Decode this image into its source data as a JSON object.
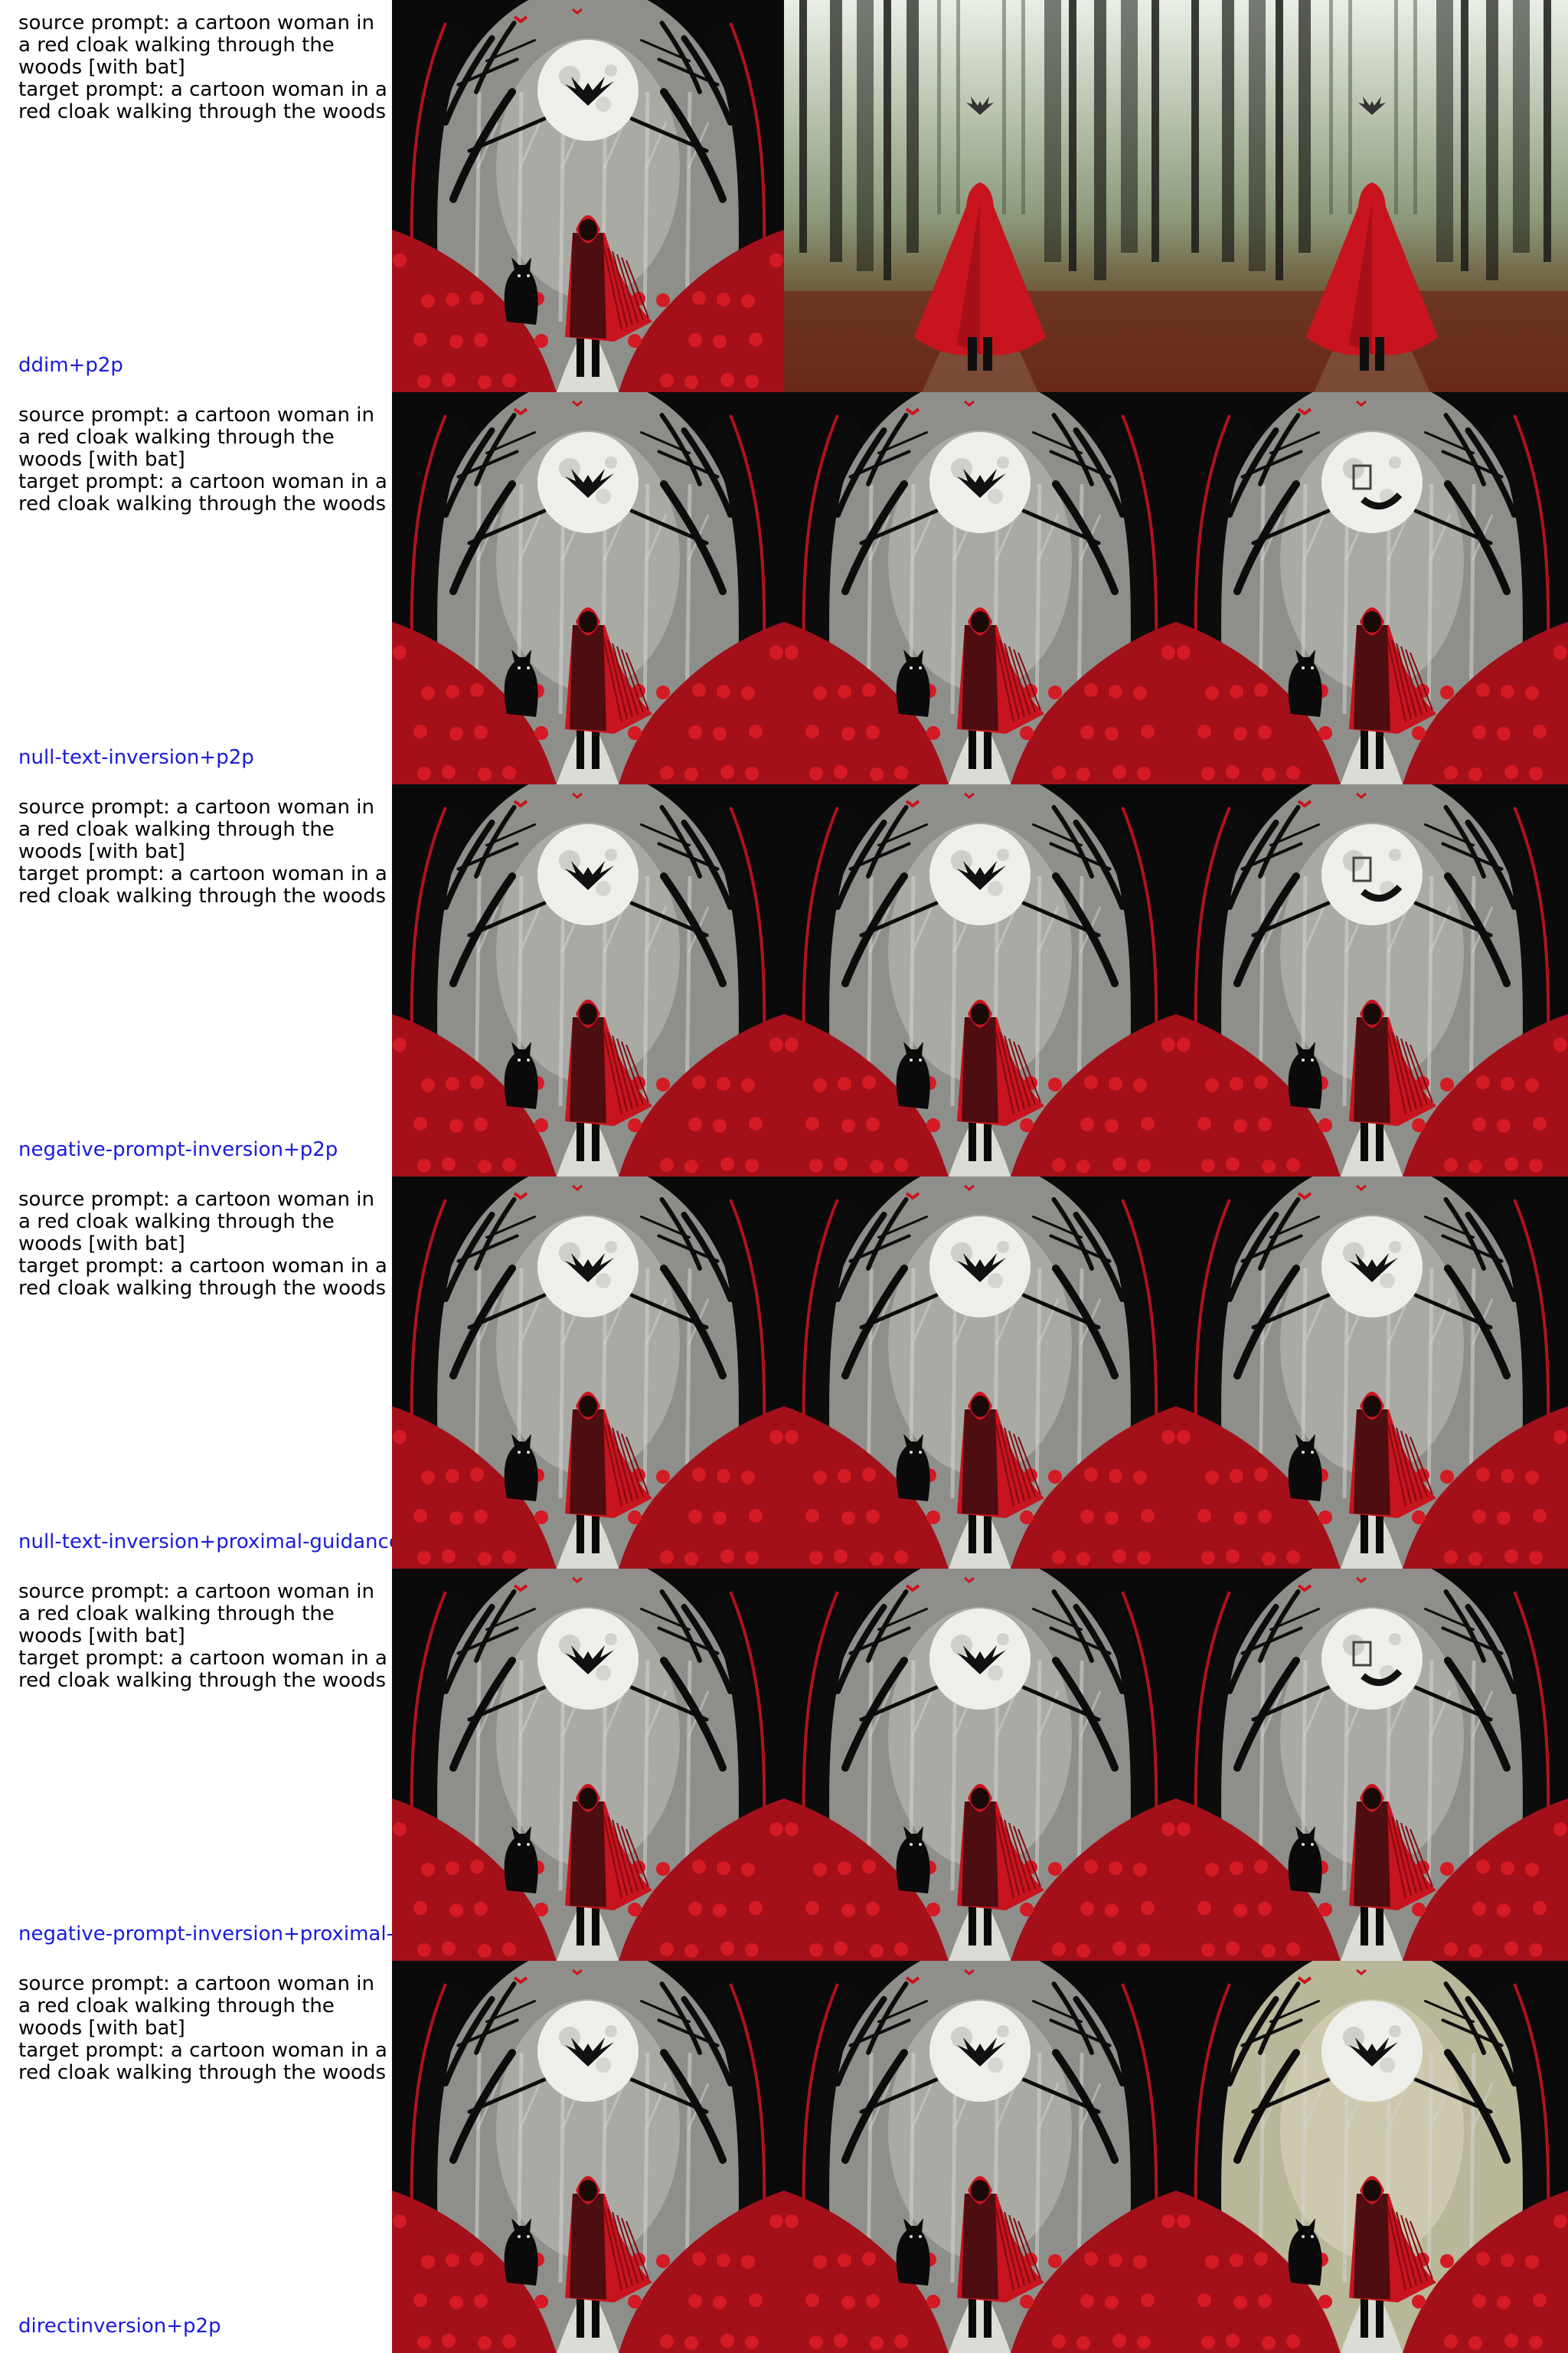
{
  "rows": [
    {
      "source_prompt": "source prompt: a cartoon woman in a red cloak walking through the woods [with bat]",
      "target_prompt": "target prompt: a cartoon woman in a red cloak walking through the woods",
      "method": "ddim+p2p",
      "images": [
        "cartoon",
        "photo",
        "photo"
      ]
    },
    {
      "source_prompt": "source prompt: a cartoon woman in a red cloak walking through the woods [with bat]",
      "target_prompt": "target prompt: a cartoon woman in a red cloak walking through the woods",
      "method": "null-text-inversion+p2p",
      "images": [
        "cartoon",
        "cartoon",
        "cartoon-ghost"
      ]
    },
    {
      "source_prompt": "source prompt: a cartoon woman in a red cloak walking through the woods [with bat]",
      "target_prompt": "target prompt: a cartoon woman in a red cloak walking through the woods",
      "method": "negative-prompt-inversion+p2p",
      "images": [
        "cartoon",
        "cartoon",
        "cartoon-ghost"
      ]
    },
    {
      "source_prompt": "source prompt: a cartoon woman in a red cloak walking through the woods [with bat]",
      "target_prompt": "target prompt: a cartoon woman in a red cloak walking through the woods",
      "method": "null-text-inversion+proximal-guidance",
      "images": [
        "cartoon",
        "cartoon",
        "cartoon"
      ]
    },
    {
      "source_prompt": "source prompt: a cartoon woman in a red cloak walking through the woods [with bat]",
      "target_prompt": "target prompt: a cartoon woman in a red cloak walking through the woods",
      "method": "negative-prompt-inversion+proximal-guidance",
      "images": [
        "cartoon",
        "cartoon",
        "cartoon-ghost"
      ]
    },
    {
      "source_prompt": "source prompt: a cartoon woman in a red cloak walking through the woods [with bat]",
      "target_prompt": "target prompt: a cartoon woman in a red cloak walking through the woods",
      "method": "directinversion+p2p",
      "images": [
        "cartoon",
        "cartoon",
        "cartoon-sepia"
      ]
    }
  ],
  "colors": {
    "cloak_red": "#c8141e",
    "moon": "#eeeeea",
    "tree_dark": "#0c0c0c",
    "method_label": "#1a1adc"
  }
}
